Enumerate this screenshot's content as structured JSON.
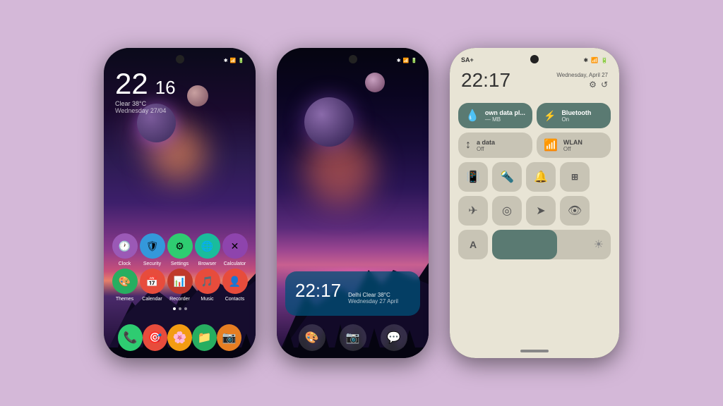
{
  "background_color": "#d4b8d8",
  "phone1": {
    "time_hour": "22",
    "time_min": "16",
    "weather": "Clear  38°C",
    "date": "Wednesday 27/04",
    "apps_row1": [
      {
        "label": "Clock",
        "color": "#9b59b6",
        "icon": "🕐"
      },
      {
        "label": "Security",
        "color": "#3498db",
        "icon": "🛡"
      },
      {
        "label": "Settings",
        "color": "#2ecc71",
        "icon": "⚙"
      },
      {
        "label": "Browser",
        "color": "#1abc9c",
        "icon": "🌐"
      },
      {
        "label": "Calculator",
        "color": "#9b59b6",
        "icon": "✕"
      }
    ],
    "apps_row2": [
      {
        "label": "Themes",
        "color": "#2ecc71",
        "icon": "🎨"
      },
      {
        "label": "Calendar",
        "color": "#e74c3c",
        "icon": "📅"
      },
      {
        "label": "Recorder",
        "color": "#c0392b",
        "icon": "📊"
      },
      {
        "label": "Music",
        "color": "#e74c3c",
        "icon": "🎵"
      },
      {
        "label": "Contacts",
        "color": "#e74c3c",
        "icon": "👤"
      }
    ],
    "dock": [
      {
        "label": "Phone",
        "color": "#2ecc71",
        "icon": "📞"
      },
      {
        "label": "Camera",
        "color": "#e74c3c",
        "icon": "🎯"
      },
      {
        "label": "Gallery",
        "color": "#f39c12",
        "icon": "🌸"
      },
      {
        "label": "Files",
        "color": "#27ae60",
        "icon": "📁"
      },
      {
        "label": "Camera2",
        "color": "#e67e22",
        "icon": "📷"
      }
    ]
  },
  "phone2": {
    "time": "22:17",
    "weather_location": "Delhi Clear 38°C",
    "date": "Wednesday 27 April",
    "dock": [
      "🎨",
      "📷",
      "💬"
    ]
  },
  "phone3": {
    "status_left": "SA+",
    "time": "22:17",
    "date_text": "Wednesday, April 27",
    "tiles": [
      {
        "name": "own data pl...",
        "sub": "— MB",
        "active": true,
        "icon": "💧"
      },
      {
        "name": "Bluetooth",
        "sub": "On",
        "active": true,
        "icon": "🔵"
      },
      {
        "name": "a  data",
        "sub": "Off",
        "active": false,
        "icon": "📶"
      },
      {
        "name": "WLAN",
        "sub": "Off",
        "active": false,
        "icon": "📡"
      }
    ],
    "small_tiles": [
      {
        "icon": "📳",
        "active": false
      },
      {
        "icon": "🔦",
        "active": false
      },
      {
        "icon": "🔔",
        "active": false
      },
      {
        "icon": "⊞",
        "active": false
      },
      {
        "icon": "✈",
        "active": false
      },
      {
        "icon": "◎",
        "active": false
      },
      {
        "icon": "➤",
        "active": false
      },
      {
        "icon": "👁",
        "active": false
      }
    ],
    "brightness_pct": 55,
    "brightness_label": "A"
  }
}
